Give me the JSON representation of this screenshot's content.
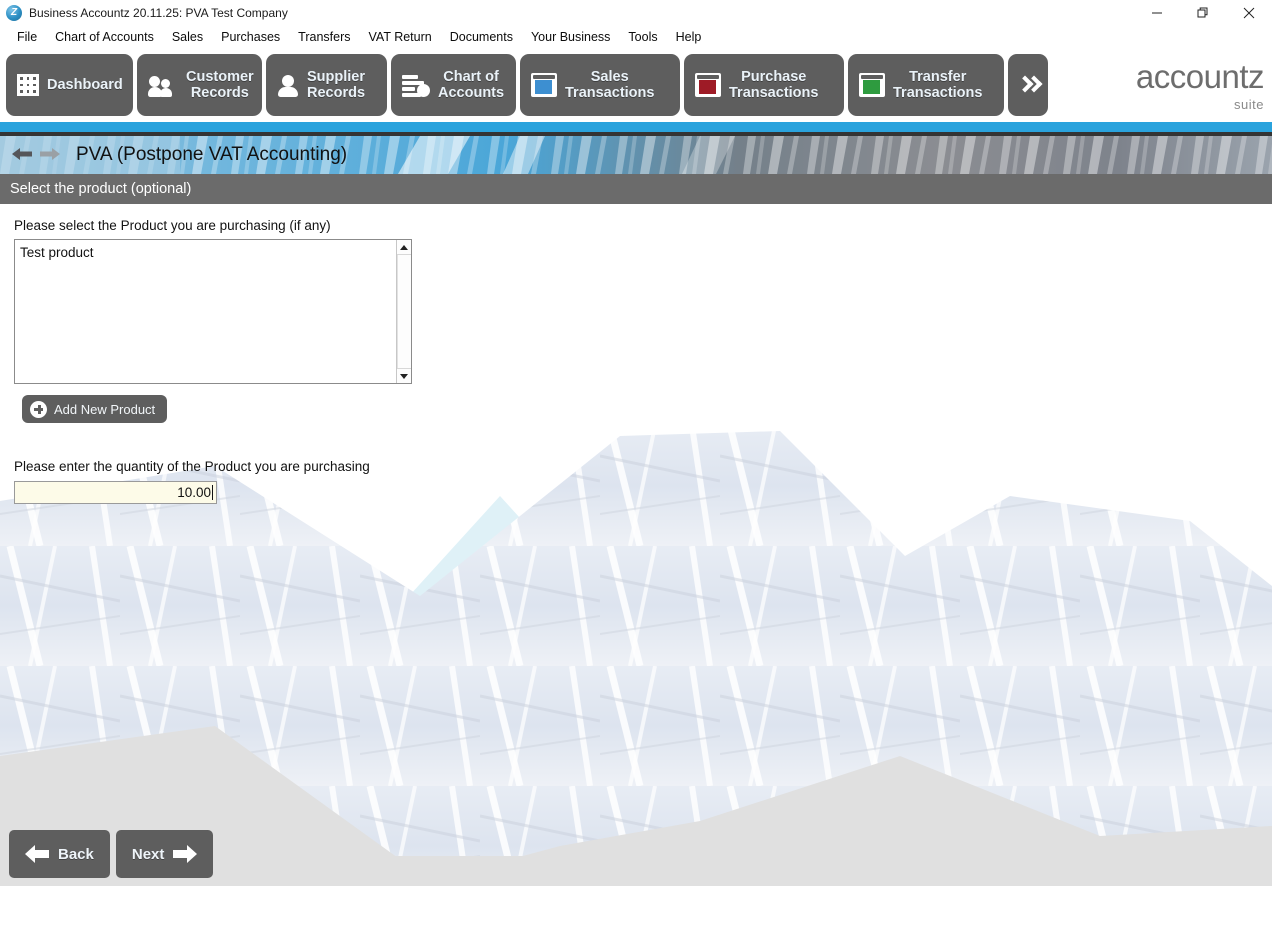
{
  "window": {
    "title": "Business Accountz 20.11.25: PVA Test Company",
    "app_icon": "accountz-z-icon",
    "minimize_label": "minimize-icon",
    "maximize_label": "restore-icon",
    "close_label": "close-icon"
  },
  "menubar": {
    "items": [
      {
        "label": "File"
      },
      {
        "label": "Chart of Accounts"
      },
      {
        "label": "Sales"
      },
      {
        "label": "Purchases"
      },
      {
        "label": "Transfers"
      },
      {
        "label": "VAT Return"
      },
      {
        "label": "Documents"
      },
      {
        "label": "Your Business"
      },
      {
        "label": "Tools"
      },
      {
        "label": "Help"
      }
    ]
  },
  "toolbar": {
    "buttons": [
      {
        "line1": "Dashboard",
        "line2": "",
        "icon": "grid-icon"
      },
      {
        "line1": "Customer",
        "line2": "Records",
        "icon": "two-people-icon"
      },
      {
        "line1": "Supplier",
        "line2": "Records",
        "icon": "person-icon"
      },
      {
        "line1": "Chart of",
        "line2": "Accounts",
        "icon": "bar-chart-icon"
      },
      {
        "line1": "Sales",
        "line2": "Transactions",
        "icon": "blue-book-icon"
      },
      {
        "line1": "Purchase",
        "line2": "Transactions",
        "icon": "red-book-icon"
      },
      {
        "line1": "Transfer",
        "line2": "Transactions",
        "icon": "green-book-icon"
      }
    ],
    "overflow_label": "double-chevron-right-icon",
    "icon_colors": {
      "sales": "#3d8fd1",
      "purchase": "#9e1b26",
      "transfer": "#2e9b3f"
    }
  },
  "brand": {
    "name": "accountz",
    "suffix": "suite"
  },
  "banner": {
    "back_arrow": "back-arrow-icon",
    "forward_arrow": "forward-arrow-icon",
    "title": "PVA (Postpone VAT Accounting)"
  },
  "subheader": {
    "text": "Select the product (optional)"
  },
  "form": {
    "product_label": "Please select the Product you are purchasing (if any)",
    "products": [
      {
        "name": "Test product"
      }
    ],
    "add_product_label": "Add New Product",
    "quantity_label": "Please enter the quantity of the Product you are purchasing",
    "quantity_value": "10.00"
  },
  "footer": {
    "back_label": "Back",
    "next_label": "Next"
  },
  "colors": {
    "accent_blue": "#2aa3dd",
    "button_gray": "#5e5e5e",
    "subheader_gray": "#6b6b6b",
    "input_cream": "#fdfbe8"
  }
}
